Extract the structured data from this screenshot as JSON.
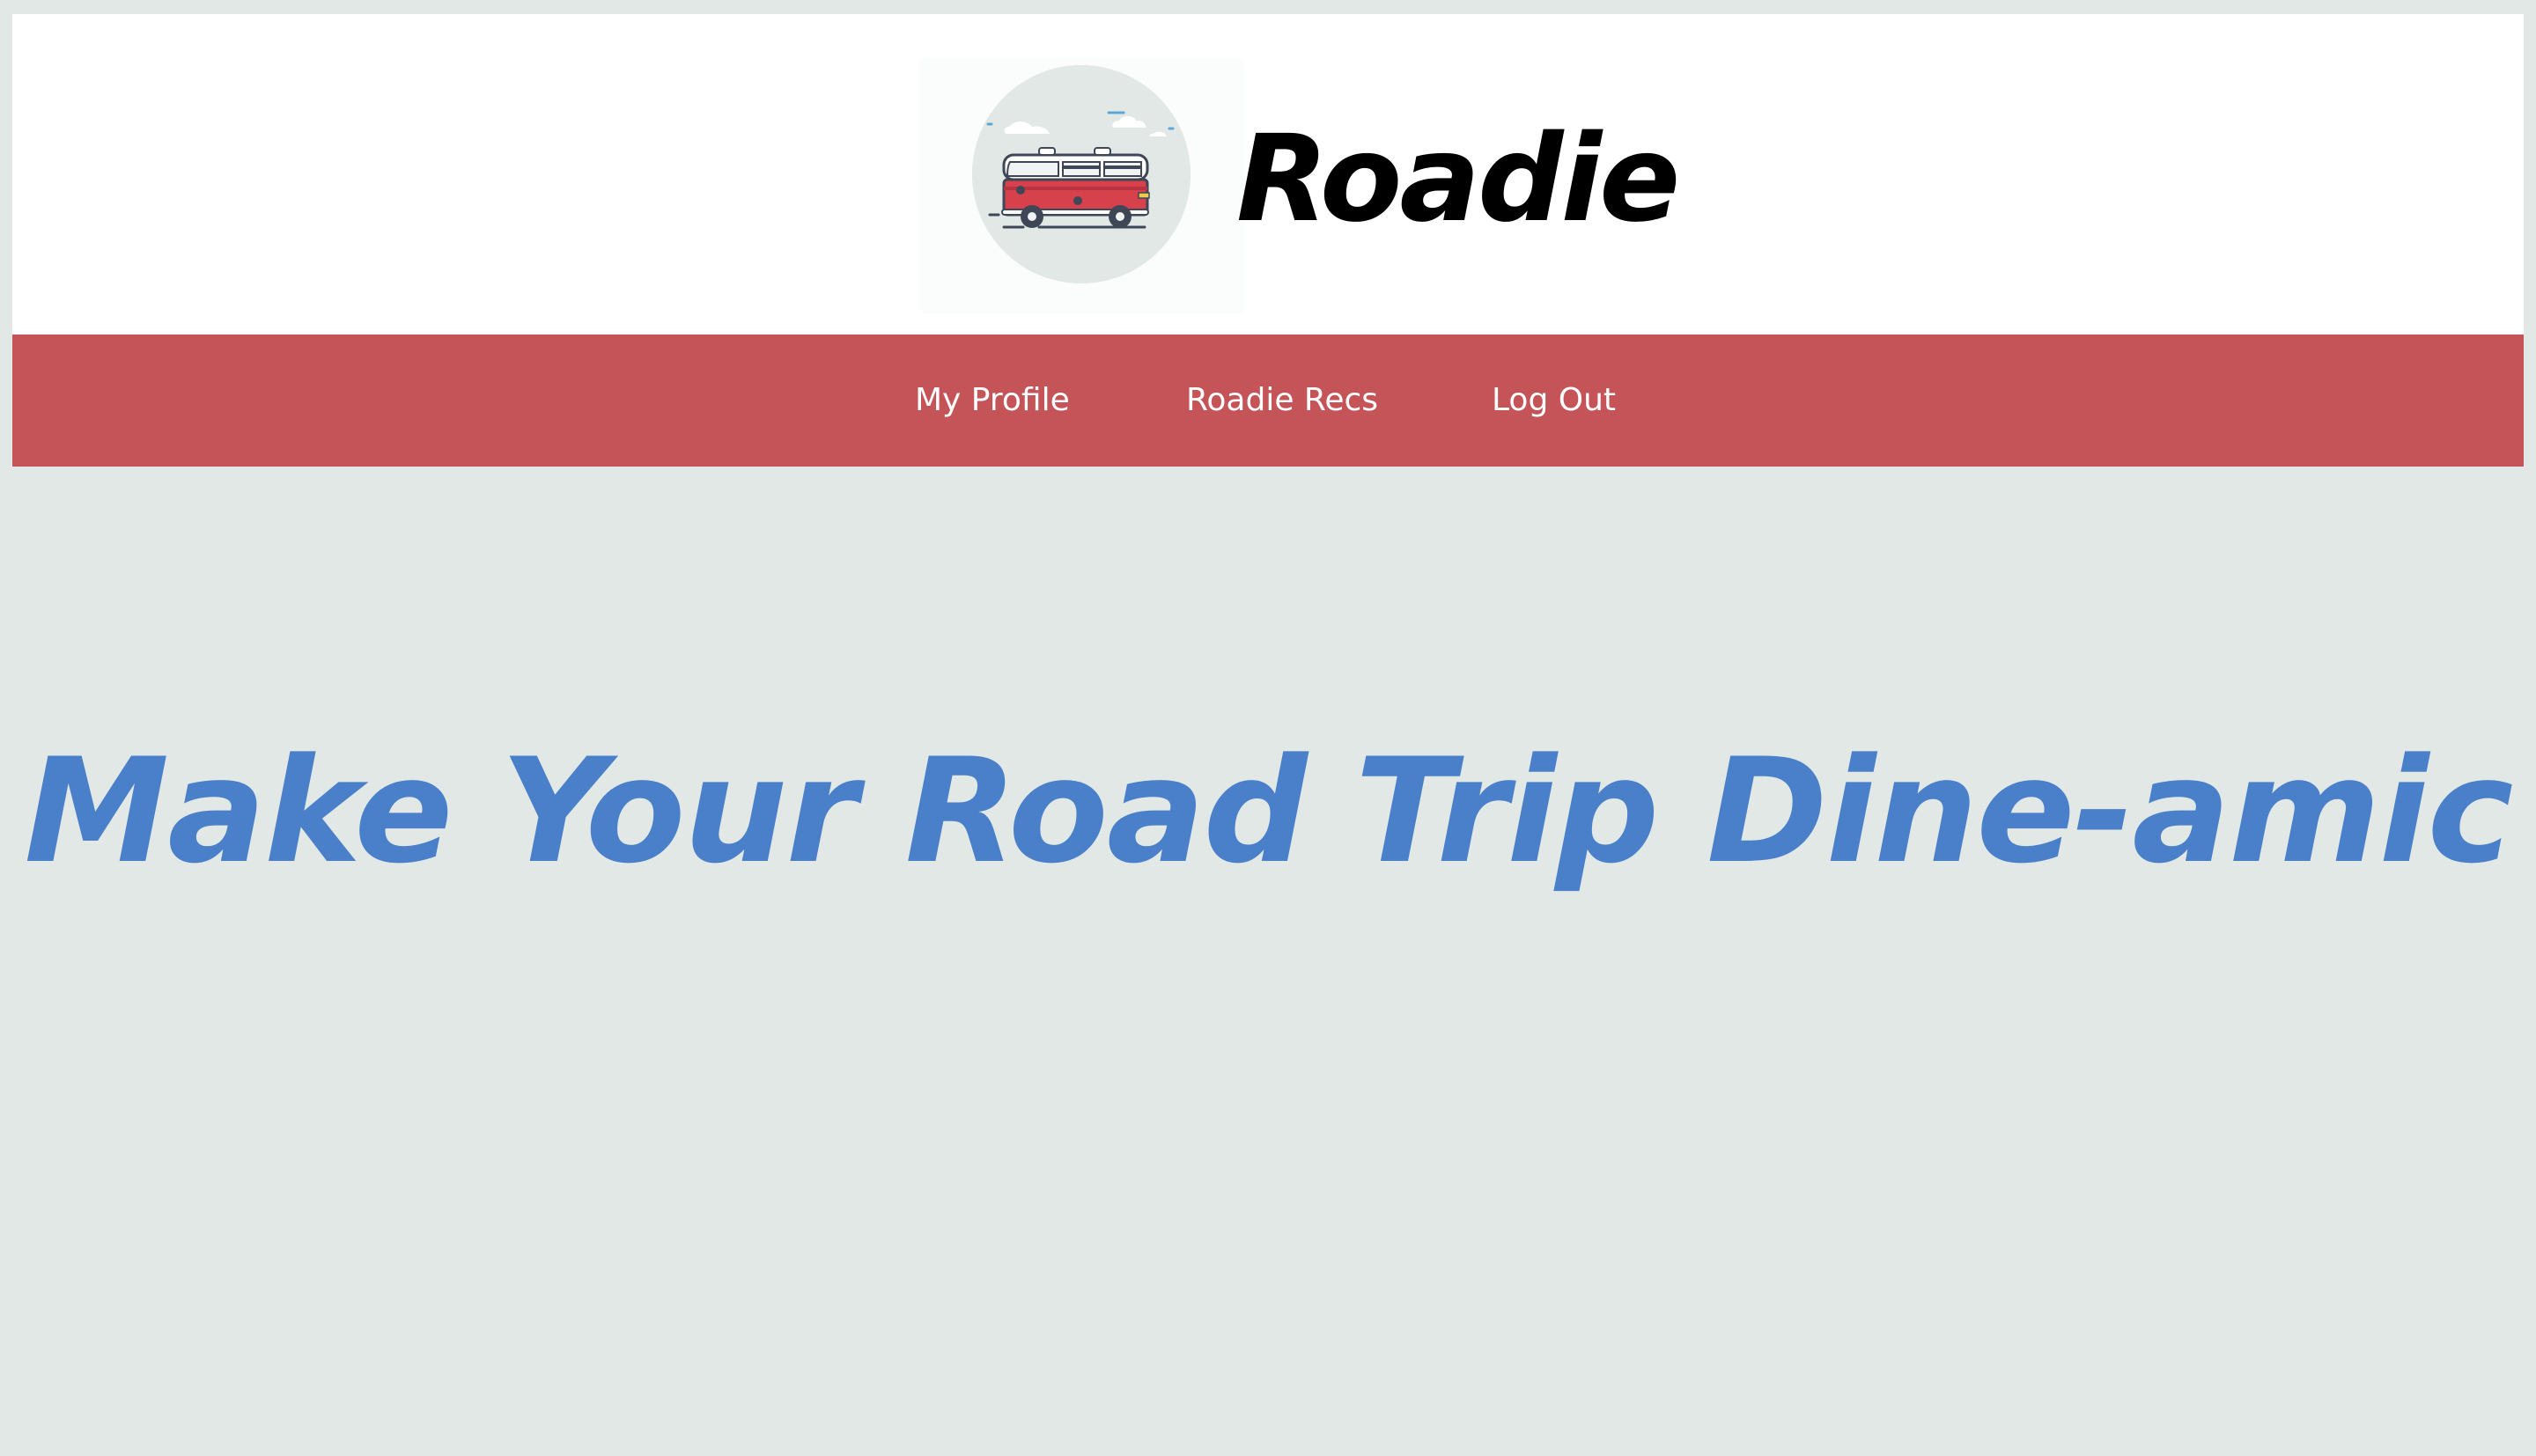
{
  "app": {
    "name": "Roadie"
  },
  "header": {
    "logo_icon": "van-icon",
    "brand_title": "Roadie"
  },
  "nav": {
    "items": [
      {
        "label": "My Profile"
      },
      {
        "label": "Roadie Recs"
      },
      {
        "label": "Log Out"
      }
    ]
  },
  "hero": {
    "title": "Make Your Road Trip Dine-amic"
  },
  "colors": {
    "page_background": "#e1e8e6",
    "header_background": "#ffffff",
    "nav_background": "#c45458",
    "nav_text": "#ffffff",
    "hero_text": "#4a80c9",
    "brand_text": "#000000",
    "logo_circle": "#e1e8e6",
    "van_red": "#d6414c"
  }
}
